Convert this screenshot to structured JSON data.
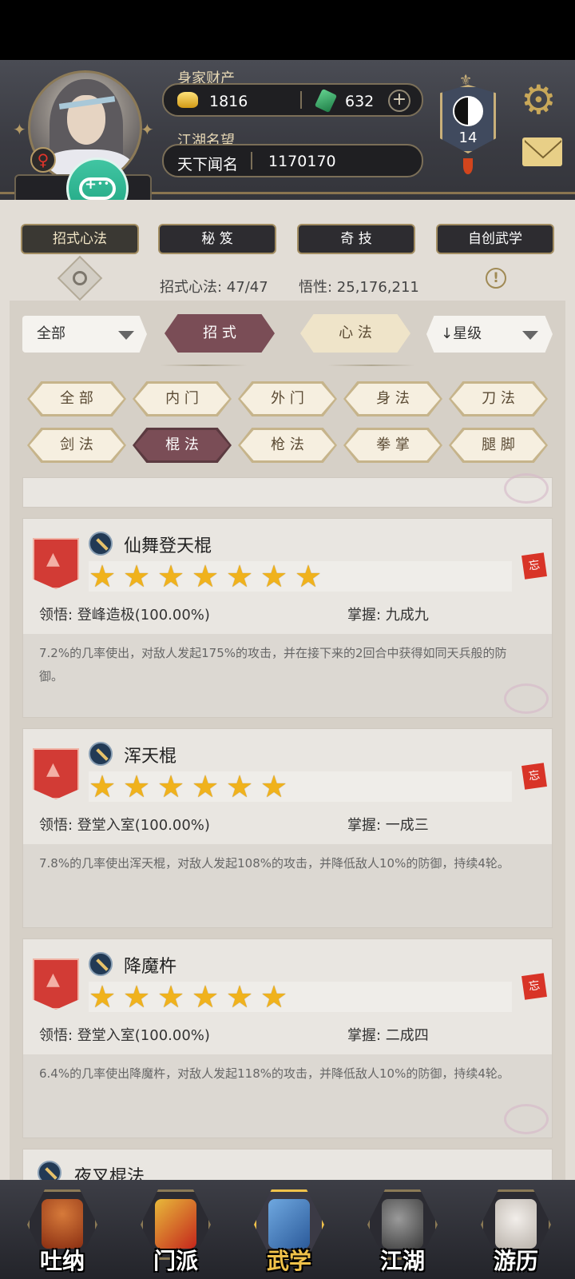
{
  "header": {
    "wealth_label": "身家财产",
    "gold": "1816",
    "jade": "632",
    "fame_label": "江湖名望",
    "fame_title": "天下闻名",
    "fame_value": "1170170",
    "rank_level": "14",
    "gender_symbol": "♀"
  },
  "top_tabs": [
    "招式心法",
    "秘 笈",
    "奇 技",
    "自创武学"
  ],
  "stats": {
    "skills_label": "招式心法: 47/47",
    "insight_label": "悟性: 25,176,211"
  },
  "filters": {
    "category_dropdown": "全部",
    "segment": [
      "招 式",
      "心 法"
    ],
    "sort": "星级",
    "chips_row1": [
      "全 部",
      "内 门",
      "外 门",
      "身 法",
      "刀 法"
    ],
    "chips_row2": [
      "剑 法",
      "棍 法",
      "枪 法",
      "拳 掌",
      "腿 脚"
    ]
  },
  "skills": [
    {
      "name": "仙舞登天棍",
      "stars": 7,
      "insight": "领悟:  登峰造极(100.00%)",
      "mastery": "掌握:  九成九",
      "description": "7.2%的几率使出，对敌人发起175%的攻击，并在接下来的2回合中获得如同天兵般的防御。"
    },
    {
      "name": "浑天棍",
      "stars": 6,
      "insight": "领悟:  登堂入室(100.00%)",
      "mastery": "掌握:  一成三",
      "description": "7.8%的几率使出浑天棍，对敌人发起108%的攻击，并降低敌人10%的防御，持续4轮。"
    },
    {
      "name": "降魔杵",
      "stars": 6,
      "insight": "领悟:  登堂入室(100.00%)",
      "mastery": "掌握:  二成四",
      "description": "6.4%的几率使出降魔杵，对敌人发起118%的攻击，并降低敌人10%的防御，持续4轮。"
    },
    {
      "name": "夜叉棍法"
    }
  ],
  "forget_glyph": "忘",
  "bottom_nav": [
    "吐纳",
    "门派",
    "武学",
    "江湖",
    "游历"
  ],
  "colors": {
    "accent_active": "#7a4d56",
    "star": "#f0b21c",
    "banner_red": "#d23b35",
    "gold_text": "#f0c24a"
  }
}
